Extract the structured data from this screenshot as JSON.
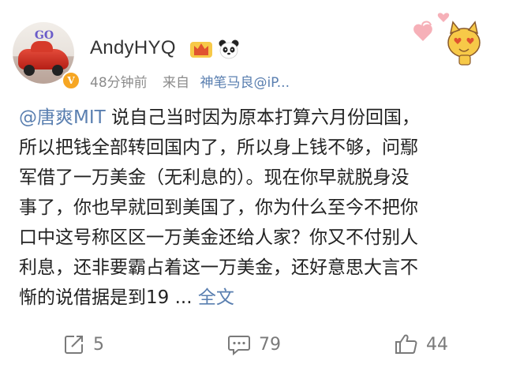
{
  "post": {
    "username": "AndyHYQ",
    "time": "48分钟前",
    "source_prefix": "来自",
    "source_name": "神笔马良@iP...",
    "text_lines": [
      {
        "mention": "@唐爽MIT",
        "text": " 说自己当时因为原本打算六月份回国，"
      },
      {
        "text": "所以把钱全部转回国内了，所以身上钱不够，问鄢"
      },
      {
        "text": "军借了一万美金（无利息的）。现在你早就脱身没"
      },
      {
        "text": "事了，你也早就回到美国了，你为什么至今不把你"
      },
      {
        "text": "口中这号称区区一万美金还给人家？你又不付别人"
      },
      {
        "text": "利息，还非要霸占着这一万美金，还好意思大言不"
      },
      {
        "text": "惭的说借据是到19 ...",
        "more": " 全文"
      }
    ],
    "actions": {
      "repost_count": "5",
      "comment_count": "79",
      "like_count": "44"
    }
  },
  "avatar": {
    "sign_text": "GO",
    "badge": "V"
  },
  "colors": {
    "link": "#5a7fb0",
    "meta": "#8c8c8c",
    "badge": "#f6a623"
  },
  "icons": [
    "crown-icon",
    "panda-icon",
    "heart-cat-sticker",
    "repost-icon",
    "comment-icon",
    "like-icon"
  ]
}
